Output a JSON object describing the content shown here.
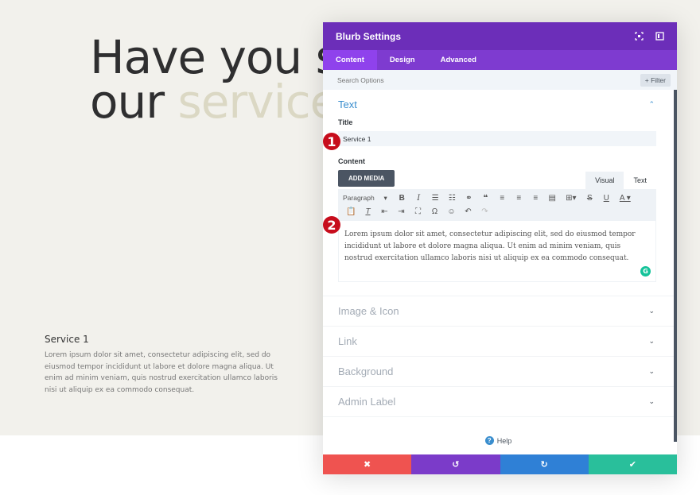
{
  "background": {
    "headline_line1": "Have you s",
    "headline_line2_plain": "our ",
    "headline_line2_accent": "service",
    "service_title": "Service 1",
    "service_text": "Lorem ipsum dolor sit amet, consectetur adipiscing elit, sed do eiusmod tempor incididunt ut labore et dolore magna aliqua. Ut enim ad minim veniam, quis nostrud exercitation ullamco laboris nisi ut aliquip ex ea commodo consequat."
  },
  "modal": {
    "title": "Blurb Settings",
    "header_icons": [
      "fullscreen-icon",
      "sidebar-toggle-icon"
    ],
    "tabs": [
      {
        "label": "Content",
        "active": true
      },
      {
        "label": "Design",
        "active": false
      },
      {
        "label": "Advanced",
        "active": false
      }
    ],
    "search": {
      "placeholder": "Search Options",
      "filter_label": "+ Filter"
    },
    "text_section": {
      "label": "Text",
      "title_label": "Title",
      "title_value": "Service 1",
      "content_label": "Content",
      "add_media_label": "ADD MEDIA",
      "mode_tabs": [
        {
          "label": "Visual",
          "active": true
        },
        {
          "label": "Text",
          "active": false
        }
      ],
      "format_select": "Paragraph",
      "body": "Lorem ipsum dolor sit amet, consectetur adipiscing elit, sed do eiusmod tempor incididunt ut labore et dolore magna aliqua. Ut enim ad minim veniam, quis nostrud exercitation ullamco laboris nisi ut aliquip ex ea commodo consequat."
    },
    "collapsed_sections": [
      {
        "label": "Image & Icon"
      },
      {
        "label": "Link"
      },
      {
        "label": "Background"
      },
      {
        "label": "Admin Label"
      }
    ],
    "help_label": "Help",
    "footer_buttons": [
      {
        "name": "cancel",
        "icon": "✖",
        "color": "#ef5350"
      },
      {
        "name": "undo",
        "icon": "↺",
        "color": "#7b3bc9"
      },
      {
        "name": "redo",
        "icon": "↻",
        "color": "#2f80d6"
      },
      {
        "name": "save",
        "icon": "✔",
        "color": "#29bf9b"
      }
    ]
  },
  "annotations": [
    "1",
    "2"
  ],
  "colors": {
    "header": "#6c2eb9",
    "tabs": "#7e3bd0",
    "active_tab": "#8f42ec",
    "link_blue": "#3a8ece",
    "marker_red": "#c70d1c"
  }
}
